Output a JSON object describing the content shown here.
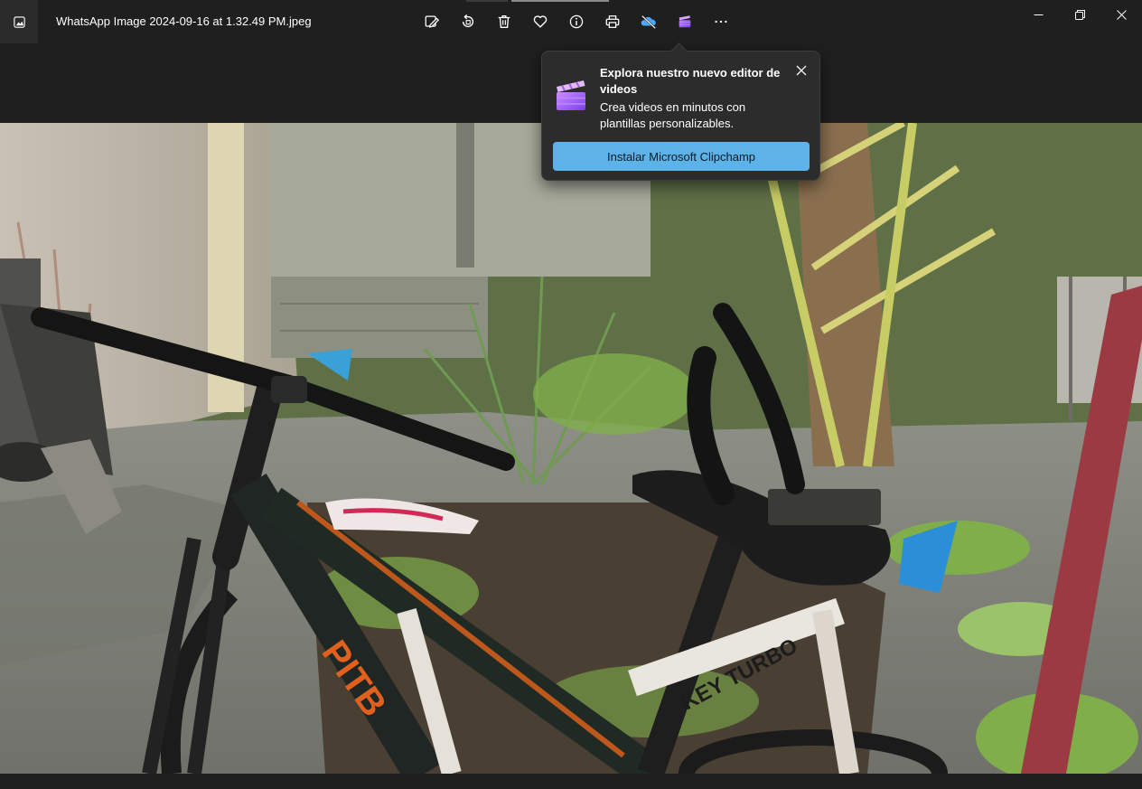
{
  "window": {
    "title": "WhatsApp Image 2024-09-16 at 1.32.49 PM.jpeg"
  },
  "toolbar": {
    "items": [
      {
        "icon": "edit-image-icon"
      },
      {
        "icon": "rotate-icon"
      },
      {
        "icon": "delete-icon"
      },
      {
        "icon": "favorite-heart-icon"
      },
      {
        "icon": "info-icon"
      },
      {
        "icon": "print-icon"
      },
      {
        "icon": "onedrive-offline-icon"
      },
      {
        "icon": "clipchamp-icon"
      },
      {
        "icon": "more-options-icon"
      }
    ]
  },
  "window_controls": [
    "minimize-icon",
    "restore-icon",
    "close-icon"
  ],
  "popup": {
    "title": "Explora nuestro nuevo editor de videos",
    "body": "Crea videos en minutos con plantillas personalizables.",
    "button_label": "Instalar Microsoft Clipchamp"
  },
  "photo": {
    "frame_text": "PITB",
    "seat_post_text": "KEY TURBO"
  },
  "colors": {
    "background": "#1f1f1f",
    "popup_bg": "#2c2c2c",
    "accent_button": "#5db2e8",
    "onedrive_blue": "#4aa8ff",
    "clipchamp_purple": "#9a5bff"
  }
}
